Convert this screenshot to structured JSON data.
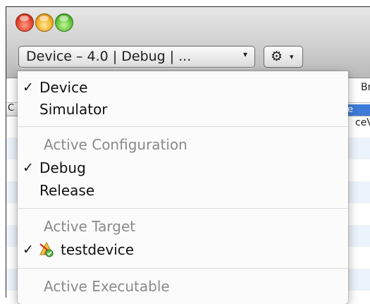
{
  "toolbar": {
    "overview_label": "Device – 4.0 | Debug | ...",
    "popup_arrow": "▾",
    "gear_glyph": "⚙",
    "gear_arrow": "▾"
  },
  "background": {
    "column_header_fragment": "Bre",
    "selected_fragment": "e",
    "row_fragment": "ceVi",
    "left_fragment": "C"
  },
  "menu": {
    "device": {
      "label": "Device",
      "checked": true,
      "check": "✓"
    },
    "simulator": {
      "label": "Simulator"
    },
    "active_configuration": {
      "header": "Active Configuration"
    },
    "debug": {
      "label": "Debug",
      "checked": true,
      "check": "✓"
    },
    "release": {
      "label": "Release"
    },
    "active_target": {
      "header": "Active Target"
    },
    "testdevice": {
      "label": "testdevice",
      "checked": true,
      "check": "✓",
      "icon": "target-app-icon"
    },
    "active_executable": {
      "header": "Active Executable"
    }
  },
  "colors": {
    "selection_blue": "#3d7bd8",
    "stripe": "#edf3fc",
    "header_gray": "#8a8a8a"
  }
}
